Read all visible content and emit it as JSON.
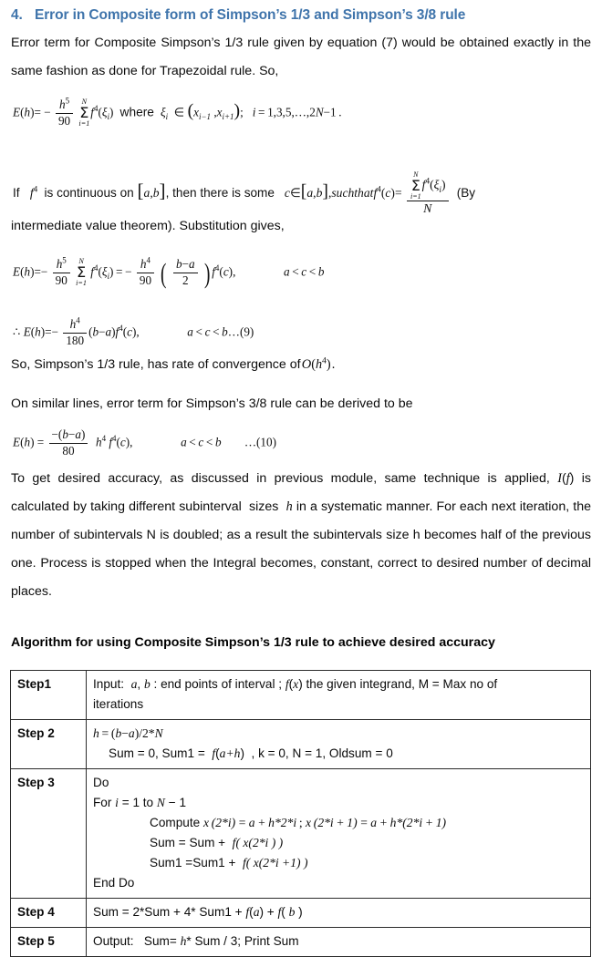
{
  "document": {
    "heading": {
      "number": "4.",
      "text": "Error in Composite form of Simpson’s 1/3 and Simpson’s 3/8 rule",
      "color": "#3f74ab"
    },
    "paragraphs": {
      "p1": "Error term for Composite Simpson’s 1/3 rule given by equation (7) would be obtained exactly in the same fashion as done for Trapezoidal rule.  So,",
      "p_intermediate": "intermediate value theorem). Substitution gives,",
      "p_rate": "So, Simpson’s 1/3 rule, has rate of convergence of O(h⁴) .",
      "p_similar": "On similar lines, error term for Simpson’s 3/8 rule can be derived to be",
      "p_accuracy": "To get desired accuracy, as discussed in previous module, same technique is applied, I(f) is calculated by taking different subinterval sizes  h in a systematic manner. For each next iteration, the number of subintervals N is doubled; as a result the subintervals size h becomes half of the previous one. Process is stopped when the Integral becomes, constant, correct to desired number of decimal places."
    },
    "equations": {
      "eq7_error": {
        "plain": "E(h) = − (h⁵/90) Σ_{i=1}^{N} f⁴(ξᵢ) where ξᵢ ∈ (xᵢ₋₁ , xᵢ₊₁); i = 1,3,5,…,2N−1 .",
        "lhs": "E(h)",
        "sign": "−",
        "frac_num": "h⁵",
        "frac_den": "90",
        "sum_upper": "N",
        "sum_lower": "i=1",
        "summand": "f⁴(ξᵢ)",
        "where": "where",
        "membership": "ξᵢ ∈ (xᵢ₋₁ , xᵢ₊₁);",
        "index_range": "i = 1,3,5,…,2N−1 ."
      },
      "mvt_line": {
        "before": "If",
        "f4": "f⁴",
        "mid1": "is continuous on",
        "interval": "[a,b]",
        "mid2": ", then there is some",
        "cond": "c ∈ [a,b], such that f⁴(c) =",
        "frac_num": "Σ_{i=1}^{N} f⁴(ξᵢ)",
        "frac_den": "N",
        "after": "(By"
      },
      "eq8_substitution": {
        "plain": "E(h) = − (h⁵/90) Σ_{i=1}^{N} f⁴(ξᵢ) = − (h⁴/90) ((b−a)/2) f⁴(c),    a < c < b",
        "condition": "a < c < b"
      },
      "eq9": {
        "plain": "∴ E(h) = − (h⁴/180) (b−a) f⁴(c),    a < c < b …(9)",
        "condition": "a < c < b…(9)",
        "frac_num": "h⁴",
        "frac_den": "180",
        "label": "…(9)"
      },
      "eq10": {
        "plain": "E(h) = (−(b−a)/80) h⁴ f⁴(c),    a < c < b  …(10)",
        "frac_num": "−(b−a)",
        "frac_den": "80",
        "condition": "a < c < b",
        "label": "…(10)"
      }
    },
    "algorithm": {
      "title": "Algorithm for using Composite Simpson’s 1/3 rule to achieve desired accuracy",
      "rows": [
        {
          "step": "Step1",
          "lines": [
            "Input:  a, b : end points of interval ; f(x) the given integrand, M = Max no of",
            "iterations"
          ],
          "indents": [
            0,
            0
          ]
        },
        {
          "step": "Step 2",
          "lines": [
            "h = (b−a)/2*N",
            "Sum = 0, Sum1 =  f(a+h)  , k = 0, N = 1, Oldsum = 0"
          ],
          "indents": [
            0,
            1
          ]
        },
        {
          "step": "Step 3",
          "lines": [
            "Do",
            "For i = 1 to N − 1",
            "Compute x (2*i) = a + h*2*i ;  x (2*i+1) = a + h*(2*i+1)",
            "Sum = Sum + f( x(2*i ) )",
            "Sum1 = Sum1 +  f( x(2*i +1) )",
            "End Do"
          ],
          "indents": [
            0,
            0,
            2,
            2,
            2,
            0
          ]
        },
        {
          "step": "Step 4",
          "lines": [
            "Sum = 2*Sum + 4* Sum1 + f(a) + f( b )"
          ],
          "indents": [
            0
          ]
        },
        {
          "step": "Step 5",
          "lines": [
            "Output:   Sum= h* Sum / 3; Print Sum"
          ],
          "indents": [
            0
          ]
        }
      ]
    }
  }
}
